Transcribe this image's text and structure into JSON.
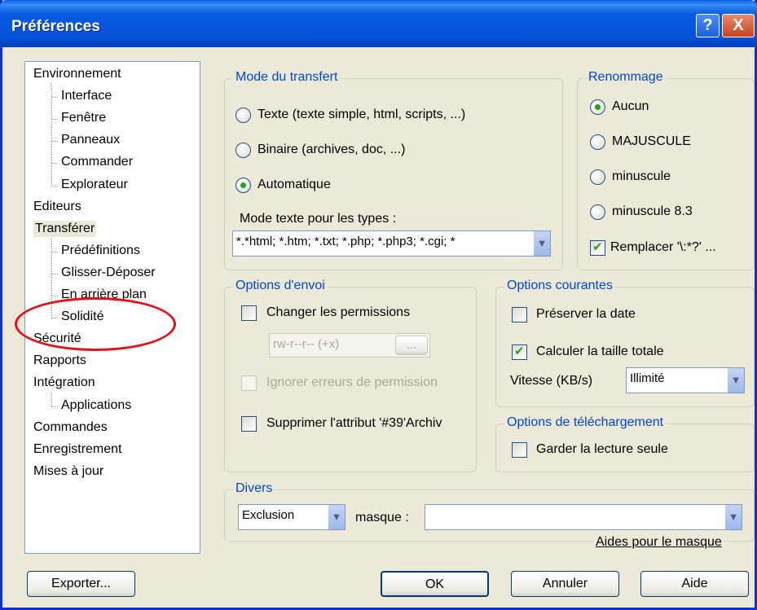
{
  "window": {
    "title": "Préférences",
    "help_glyph": "?",
    "close_glyph": "X"
  },
  "tree": [
    {
      "label": "Environnement",
      "level": 0
    },
    {
      "label": "Interface",
      "level": 1
    },
    {
      "label": "Fenêtre",
      "level": 1
    },
    {
      "label": "Panneaux",
      "level": 1
    },
    {
      "label": "Commander",
      "level": 1
    },
    {
      "label": "Explorateur",
      "level": 1
    },
    {
      "label": "Editeurs",
      "level": 0
    },
    {
      "label": "Transférer",
      "level": 0,
      "selected": true
    },
    {
      "label": "Prédéfinitions",
      "level": 1
    },
    {
      "label": "Glisser-Déposer",
      "level": 1
    },
    {
      "label": "En arrière plan",
      "level": 1
    },
    {
      "label": "Solidité",
      "level": 1
    },
    {
      "label": "Sécurité",
      "level": 0
    },
    {
      "label": "Rapports",
      "level": 0
    },
    {
      "label": "Intégration",
      "level": 0
    },
    {
      "label": "Applications",
      "level": 1
    },
    {
      "label": "Commandes",
      "level": 0
    },
    {
      "label": "Enregistrement",
      "level": 0
    },
    {
      "label": "Mises à jour",
      "level": 0
    }
  ],
  "transfer_mode": {
    "legend": "Mode du transfert",
    "text_label": "Texte (texte simple, html, scripts, ...)",
    "binary_label": "Binaire (archives, doc, ...)",
    "auto_label": "Automatique",
    "selected": "auto",
    "types_label": "Mode texte pour les types :",
    "types_value": "*.*html; *.htm; *.txt; *.php; *.php3; *.cgi; *"
  },
  "rename": {
    "legend": "Renommage",
    "none": "Aucun",
    "upper": "MAJUSCULE",
    "lower": "minuscule",
    "lower83": "minuscule 8.3",
    "selected": "none",
    "replace_label": "Remplacer '\\:*?' ...",
    "replace_checked": true
  },
  "send_options": {
    "legend": "Options d'envoi",
    "change_perms": "Changer les permissions",
    "perms_value": "rw-r--r-- (+x)",
    "perms_button": "...",
    "ignore_errors": "Ignorer erreurs de permission",
    "remove_archive": "Supprimer l'attribut '#39'Archiv"
  },
  "common_options": {
    "legend": "Options courantes",
    "preserve_date": "Préserver la date",
    "preserve_date_checked": false,
    "calc_total": "Calculer la taille totale",
    "calc_total_checked": true,
    "speed_label": "Vitesse (KB/s)",
    "speed_value": "Illimité"
  },
  "download_options": {
    "legend": "Options de téléchargement",
    "keep_readonly": "Garder la lecture seule"
  },
  "misc": {
    "legend": "Divers",
    "exclusion": "Exclusion",
    "mask_label": "masque :",
    "mask_value": "",
    "mask_help": "Aides pour le masque"
  },
  "buttons": {
    "export": "Exporter...",
    "ok": "OK",
    "cancel": "Annuler",
    "help": "Aide"
  },
  "colors": {
    "title_bar": "#0553d7",
    "dialog_bg": "#ece9d8",
    "legend_text": "#0046d5",
    "annotation": "#e0121c"
  }
}
